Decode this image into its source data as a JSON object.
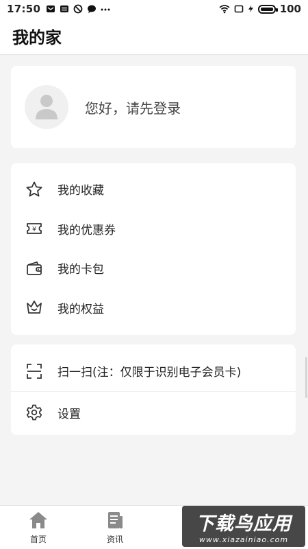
{
  "status_bar": {
    "time": "17:50",
    "battery": "100",
    "icons": [
      "mail-icon",
      "notes-icon",
      "block-icon",
      "chat-icon",
      "more-icon",
      "wifi-icon",
      "screen-icon",
      "charging-icon",
      "battery-icon"
    ]
  },
  "header": {
    "title": "我的家"
  },
  "profile": {
    "greeting": "您好，请先登录",
    "icon": "avatar-icon"
  },
  "menu_main": {
    "items": [
      {
        "label": "我的收藏",
        "icon": "star-icon"
      },
      {
        "label": "我的优惠券",
        "icon": "coupon-icon"
      },
      {
        "label": "我的卡包",
        "icon": "wallet-icon"
      },
      {
        "label": "我的权益",
        "icon": "crown-icon"
      }
    ]
  },
  "menu_tools": {
    "items": [
      {
        "label": "扫一扫(注：仅限于识别电子会员卡)",
        "icon": "scan-icon"
      },
      {
        "label": "设置",
        "icon": "gear-icon"
      }
    ]
  },
  "tabbar": {
    "tabs": [
      {
        "label": "首页",
        "icon": "home-icon"
      },
      {
        "label": "资讯",
        "icon": "news-icon"
      }
    ]
  },
  "watermark": {
    "title": "下载鸟应用",
    "url": "www.xiazainiao.com"
  },
  "colors": {
    "background": "#f4f4f4",
    "card": "#ffffff",
    "icon": "#333333"
  }
}
